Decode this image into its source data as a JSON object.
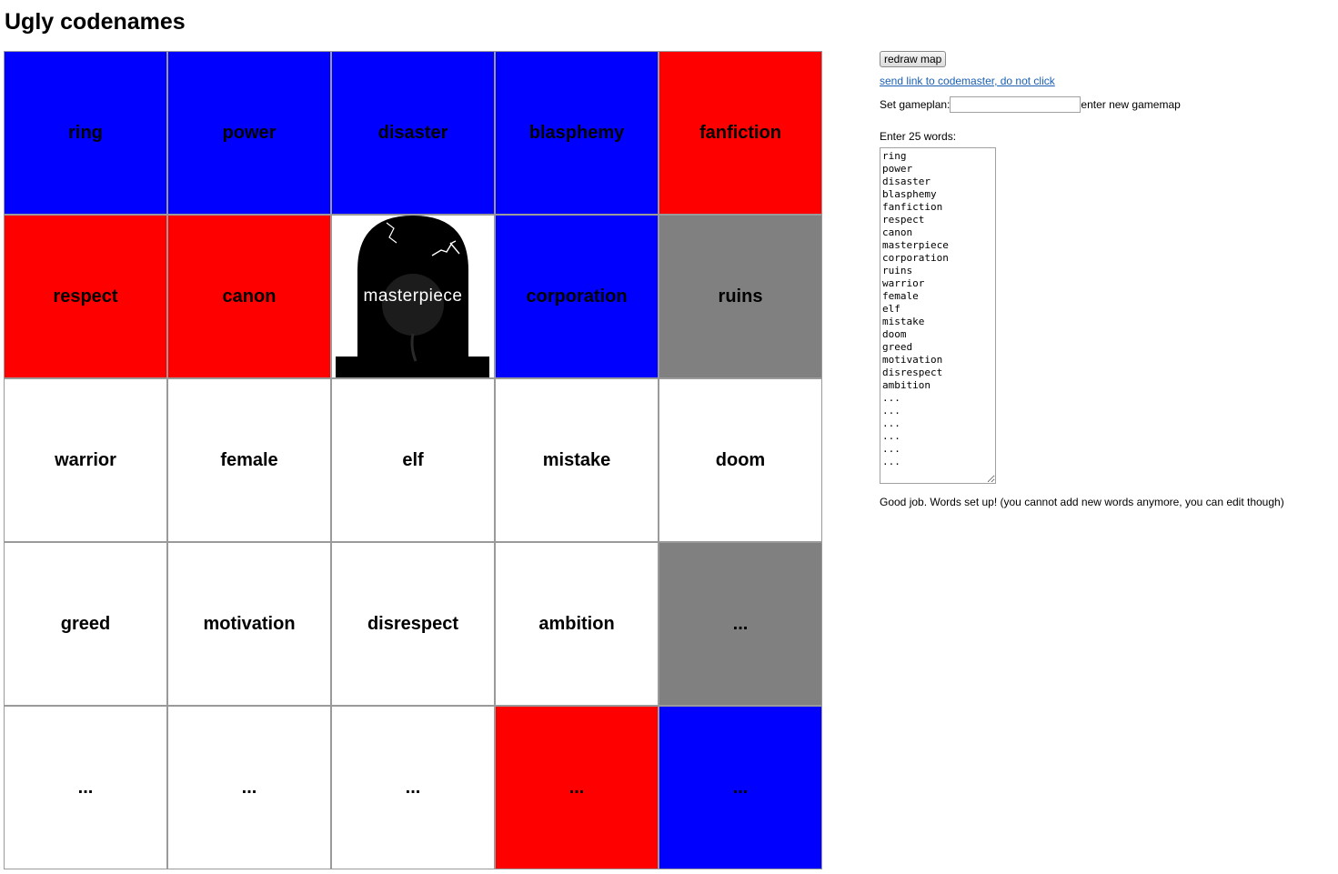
{
  "title": "Ugly codenames",
  "board": [
    {
      "word": "ring",
      "color": "blue"
    },
    {
      "word": "power",
      "color": "blue"
    },
    {
      "word": "disaster",
      "color": "blue"
    },
    {
      "word": "blasphemy",
      "color": "blue"
    },
    {
      "word": "fanfiction",
      "color": "red"
    },
    {
      "word": "respect",
      "color": "red"
    },
    {
      "word": "canon",
      "color": "red"
    },
    {
      "word": "masterpiece",
      "color": "black"
    },
    {
      "word": "corporation",
      "color": "blue"
    },
    {
      "word": "ruins",
      "color": "gray"
    },
    {
      "word": "warrior",
      "color": "white"
    },
    {
      "word": "female",
      "color": "white"
    },
    {
      "word": "elf",
      "color": "white"
    },
    {
      "word": "mistake",
      "color": "white"
    },
    {
      "word": "doom",
      "color": "white"
    },
    {
      "word": "greed",
      "color": "white"
    },
    {
      "word": "motivation",
      "color": "white"
    },
    {
      "word": "disrespect",
      "color": "white"
    },
    {
      "word": "ambition",
      "color": "white"
    },
    {
      "word": "...",
      "color": "gray"
    },
    {
      "word": "...",
      "color": "white"
    },
    {
      "word": "...",
      "color": "white"
    },
    {
      "word": "...",
      "color": "white"
    },
    {
      "word": "...",
      "color": "red"
    },
    {
      "word": "...",
      "color": "blue"
    }
  ],
  "colors": {
    "blue": "#0000ff",
    "red": "#ff0000",
    "gray": "#808080",
    "white": "#ffffff",
    "black": "#000000"
  },
  "panel": {
    "redraw_button": "redraw map",
    "codemaster_link": "send link to codemaster, do not click",
    "gameplan_label": "Set gameplan:",
    "gameplan_value": "",
    "gameplan_hint": "enter new gamemap",
    "words_label": "Enter 25 words:",
    "words_text": "ring\npower\ndisaster\nblasphemy\nfanfiction\nrespect\ncanon\nmasterpiece\ncorporation\nruins\nwarrior\nfemale\nelf\nmistake\ndoom\ngreed\nmotivation\ndisrespect\nambition\n...\n...\n...\n...\n...\n...",
    "status": "Good job. Words set up! (you cannot add new words anymore, you can edit though)"
  }
}
